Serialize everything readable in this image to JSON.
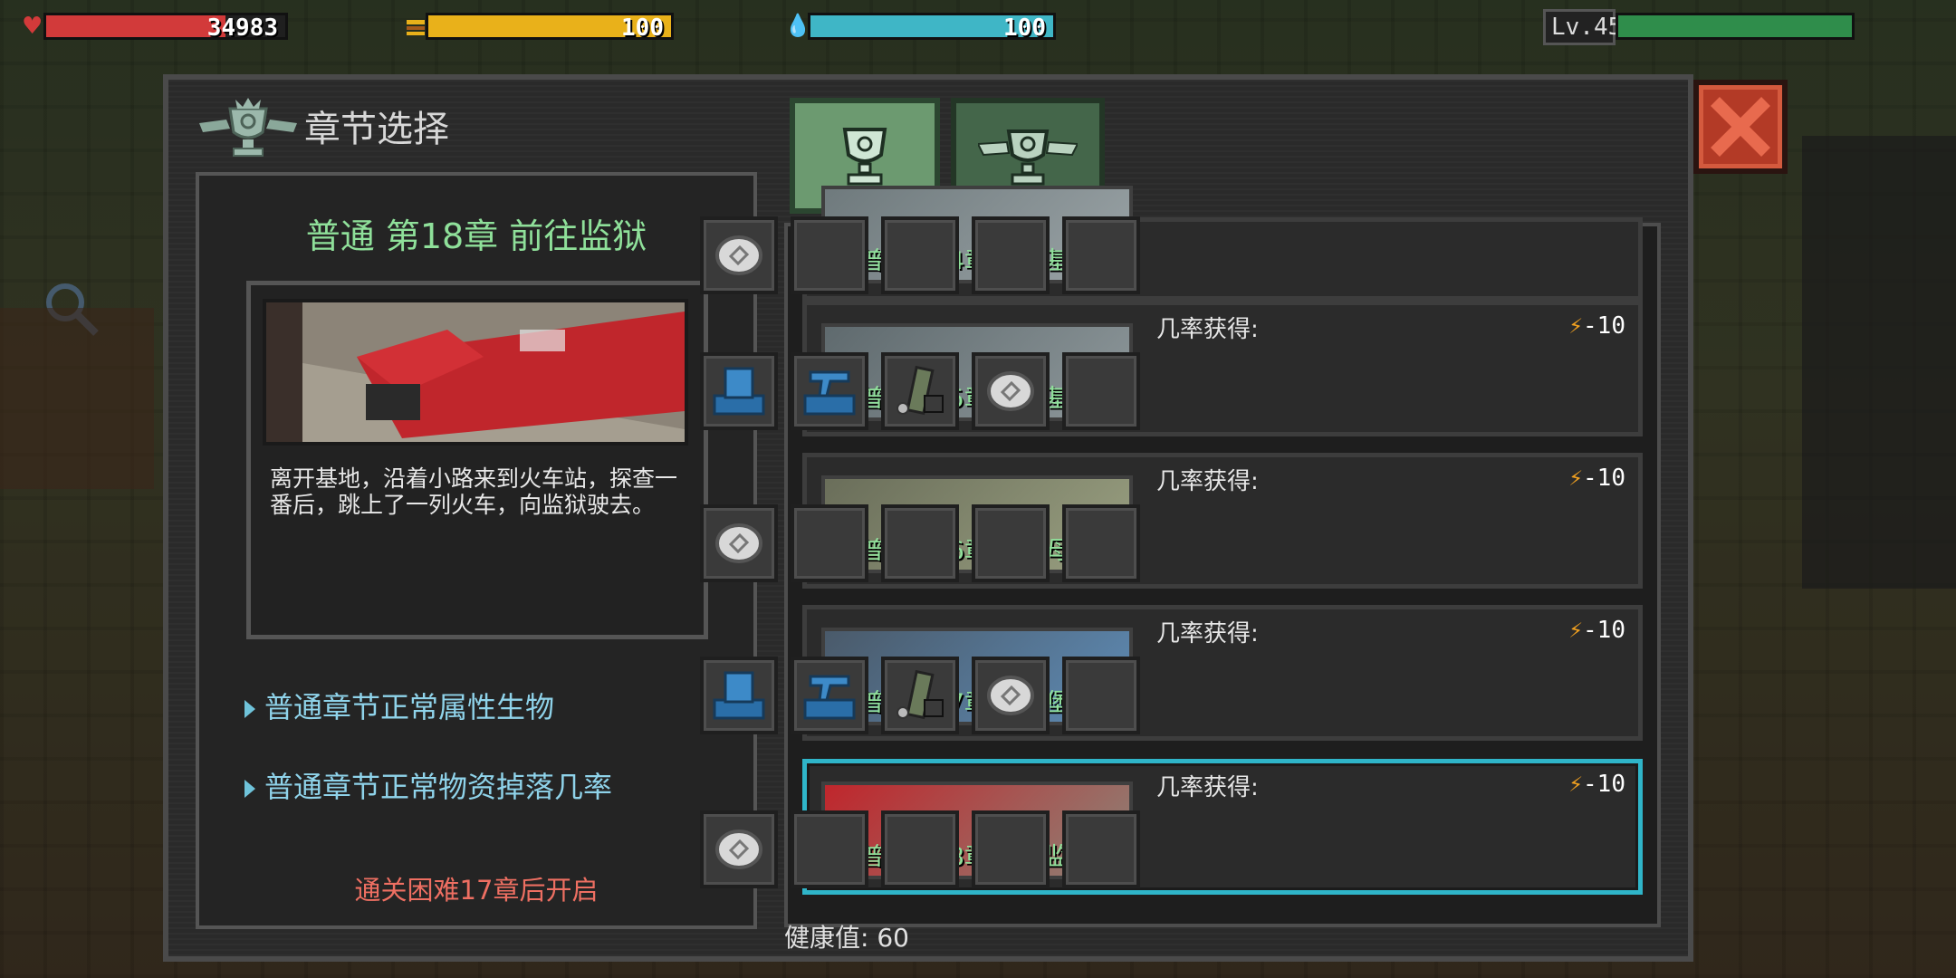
{
  "hud": {
    "health": {
      "value": "34983",
      "fill": 0.75,
      "icon": "heart-icon",
      "color": "#d23a3a"
    },
    "food": {
      "value": "100",
      "fill": 1.0,
      "icon": "food-icon",
      "color": "#e9b11a"
    },
    "water": {
      "value": "100",
      "fill": 1.0,
      "icon": "water-drop-icon",
      "color": "#3fb6c6"
    },
    "level": {
      "label": "Lv.45",
      "fill": 1.0,
      "color": "#2f8d4b"
    }
  },
  "dialog": {
    "title": "章节选择",
    "tabs": [
      {
        "name": "normal-mode-tab",
        "icon": "trophy-icon",
        "active": true
      },
      {
        "name": "hard-mode-tab",
        "icon": "winged-trophy-icon",
        "active": false
      }
    ]
  },
  "detail": {
    "chapter_title": "普通 第18章 前往监狱",
    "description": "离开基地，沿着小路来到火车站，探查一番后，跳上了一列火车，向监狱驶去。",
    "link1": "普通章节正常属性生物",
    "link2": "普通章节正常物资掉落几率",
    "unlock_note": "通关困难17章后开启"
  },
  "chapters": [
    {
      "label": "普通第14章 前往基地",
      "odds_label": "",
      "cost": "",
      "drops": [
        "coin",
        "",
        "",
        "",
        ""
      ]
    },
    {
      "label": "普通第15章 踏入基地",
      "odds_label": "几率获得:",
      "cost": "-10",
      "drops": [
        "armor-box",
        "gun-box",
        "ammo",
        "coin",
        ""
      ]
    },
    {
      "label": "普通第16章 航空母舰",
      "odds_label": "几率获得:",
      "cost": "-10",
      "drops": [
        "coin",
        "",
        "",
        "",
        ""
      ]
    },
    {
      "label": "普通第17章 军事堡垒",
      "odds_label": "几率获得:",
      "cost": "-10",
      "drops": [
        "armor-box",
        "gun-box",
        "ammo",
        "coin",
        ""
      ]
    },
    {
      "label": "普通第18章 前往监狱",
      "odds_label": "几率获得:",
      "cost": "-10",
      "drops": [
        "coin",
        "",
        "",
        "",
        ""
      ],
      "selected": true
    }
  ],
  "footer": {
    "health_label": "健康值: 60"
  }
}
